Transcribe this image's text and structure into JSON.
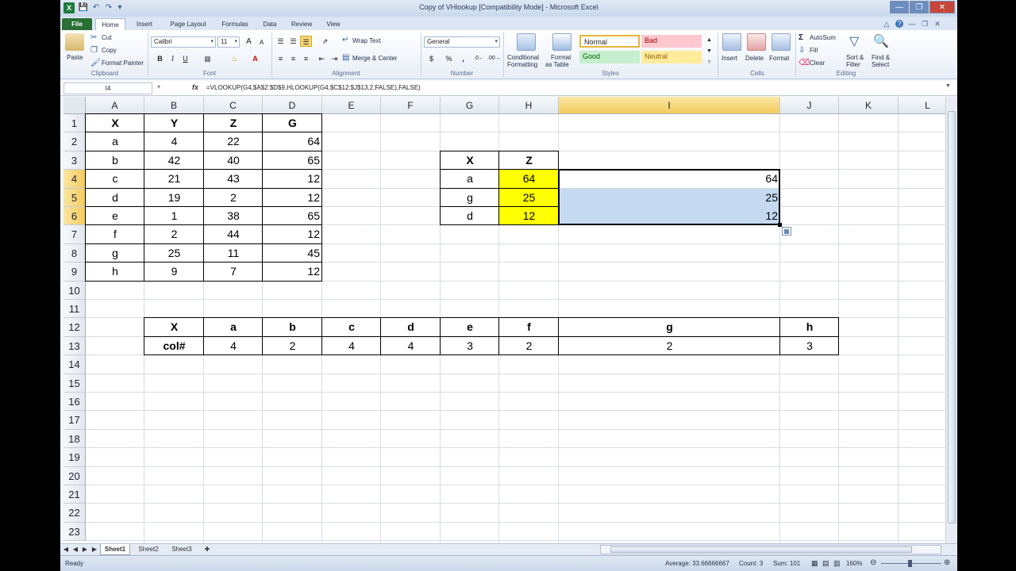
{
  "window": {
    "title": "Copy of VHlookup  [Compatibility Mode] - Microsoft Excel",
    "app_icon": "X"
  },
  "ribbon": {
    "tabs": [
      "File",
      "Home",
      "Insert",
      "Page Layout",
      "Formulas",
      "Data",
      "Review",
      "View"
    ],
    "active_tab": "Home",
    "clipboard": {
      "paste": "Paste",
      "cut": "Cut",
      "copy": "Copy",
      "format_painter": "Format Painter",
      "label": "Clipboard"
    },
    "font": {
      "name": "Calibri",
      "size": "11",
      "bold": "B",
      "italic": "I",
      "underline": "U",
      "grow": "A",
      "shrink": "A",
      "label": "Font"
    },
    "alignment": {
      "wrap_text": "Wrap Text",
      "merge_center": "Merge & Center",
      "label": "Alignment"
    },
    "number": {
      "format": "General",
      "currency": "$",
      "percent": "%",
      "comma": ",",
      "label": "Number"
    },
    "styles": {
      "conditional": "Conditional",
      "conditional2": "Formatting",
      "format_table": "Format",
      "format_table2": "as Table",
      "normal": "Normal",
      "bad": "Bad",
      "good": "Good",
      "neutral": "Neutral",
      "label": "Styles"
    },
    "cells": {
      "insert": "Insert",
      "delete": "Delete",
      "format": "Format",
      "label": "Cells"
    },
    "editing": {
      "autosum": "AutoSum",
      "fill": "Fill",
      "clear": "Clear",
      "sort": "Sort &",
      "sort2": "Filter",
      "find": "Find &",
      "find2": "Select",
      "label": "Editing"
    }
  },
  "formula_bar": {
    "name_box": "I4",
    "fx": "fx",
    "formula": "=VLOOKUP(G4,$A$2:$D$9,HLOOKUP(G4,$C$12:$J$13,2,FALSE),FALSE)"
  },
  "grid": {
    "columns": [
      "A",
      "B",
      "C",
      "D",
      "E",
      "F",
      "G",
      "H",
      "I",
      "J",
      "K",
      "L"
    ],
    "rows": [
      "1",
      "2",
      "3",
      "4",
      "5",
      "6",
      "7",
      "8",
      "9",
      "10",
      "11",
      "12",
      "13",
      "14",
      "15",
      "16",
      "17",
      "18",
      "19",
      "20",
      "21",
      "22",
      "23"
    ],
    "selected_column": "I",
    "selected_rows": [
      "4",
      "5",
      "6"
    ],
    "main_table": {
      "header": [
        "X",
        "Y",
        "Z",
        "G"
      ],
      "rows": [
        [
          "a",
          "4",
          "22",
          "64"
        ],
        [
          "b",
          "42",
          "40",
          "65"
        ],
        [
          "c",
          "21",
          "43",
          "12"
        ],
        [
          "d",
          "19",
          "2",
          "12"
        ],
        [
          "e",
          "1",
          "38",
          "65"
        ],
        [
          "f",
          "2",
          "44",
          "12"
        ],
        [
          "g",
          "25",
          "11",
          "45"
        ],
        [
          "h",
          "9",
          "7",
          "12"
        ]
      ]
    },
    "lookup_table": {
      "header": [
        "X",
        "Z"
      ],
      "rows": [
        [
          "a",
          "64"
        ],
        [
          "g",
          "25"
        ],
        [
          "d",
          "12"
        ]
      ],
      "results": [
        "64",
        "25",
        "12"
      ]
    },
    "col_table": {
      "header": [
        "X",
        "a",
        "b",
        "c",
        "d",
        "e",
        "f",
        "g",
        "h"
      ],
      "values": [
        "col#",
        "4",
        "2",
        "4",
        "4",
        "3",
        "2",
        "2",
        "3"
      ]
    },
    "colors": {
      "highlight_yellow": "#ffff00",
      "selection_blue": "#c5d9f1",
      "header_selected": "#f6d26b"
    }
  },
  "sheets": {
    "tabs": [
      "Sheet1",
      "Sheet2",
      "Sheet3"
    ],
    "active": "Sheet1"
  },
  "status_bar": {
    "ready": "Ready",
    "average": "Average: 33.66666667",
    "count": "Count: 3",
    "sum": "Sum: 101",
    "zoom": "160%"
  }
}
